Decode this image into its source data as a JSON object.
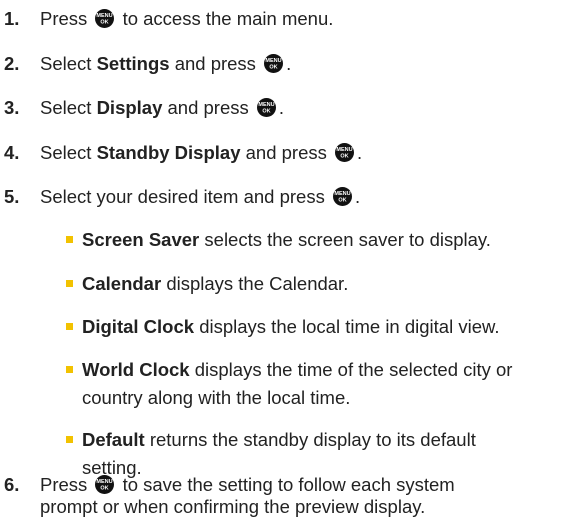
{
  "steps": [
    {
      "num": "1.",
      "a": "Press",
      "b": "to access the main menu."
    },
    {
      "num": "2.",
      "a": "Select",
      "bold": "Settings",
      "b": "and press",
      "end": "."
    },
    {
      "num": "3.",
      "a": "Select",
      "bold": "Display",
      "b": "and press",
      "end": "."
    },
    {
      "num": "4.",
      "a": "Select",
      "bold": "Standby Display",
      "b": "and press",
      "end": "."
    },
    {
      "num": "5.",
      "a": "Select your desired item and press",
      "end": "."
    },
    {
      "num": "6.",
      "a": "Press",
      "b": "to save the setting to follow each system",
      "c": "prompt or when confirming the preview display."
    }
  ],
  "bullets": [
    {
      "bold": "Screen Saver",
      "text": "selects the screen saver to display."
    },
    {
      "bold": "Calendar",
      "text": "displays the Calendar."
    },
    {
      "bold": "Digital Clock",
      "text": "displays the local time in digital view."
    },
    {
      "bold": "World Clock",
      "text": "displays the time of the selected city or",
      "text2": "country along with the local time."
    },
    {
      "bold": "Default",
      "text": "returns the standby display to its default",
      "text2": "setting."
    }
  ],
  "icon": {
    "name": "menu-ok-key-icon",
    "label_top": "MENU",
    "label_bottom": "OK",
    "color": "#111111"
  },
  "bullet_color": "#f2c200"
}
